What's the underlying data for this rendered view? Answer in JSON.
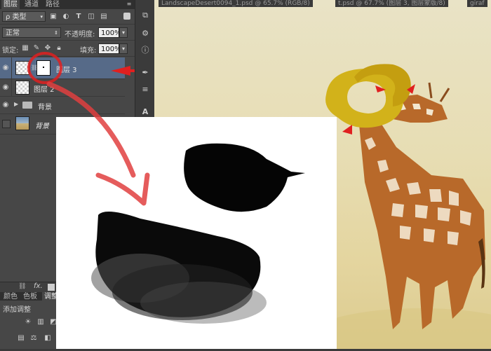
{
  "layers_panel": {
    "tabs": [
      {
        "label": "图层",
        "active": true
      },
      {
        "label": "通道",
        "active": false
      },
      {
        "label": "路径",
        "active": false
      }
    ],
    "filter": {
      "label": "ρ 类型"
    },
    "blend_mode": "正常",
    "opacity_label": "不透明度:",
    "opacity_value": "100%",
    "lock_label": "锁定:",
    "fill_label": "填充:",
    "fill_value": "100%",
    "layers": [
      {
        "name": "图层 3",
        "selected": true,
        "has_mask": true
      },
      {
        "name": "图层 2",
        "selected": false,
        "has_mask": false
      },
      {
        "name": "背景",
        "is_group": true
      },
      {
        "name": "背景",
        "is_background": true
      }
    ],
    "footer": {
      "fx_label": "fx."
    }
  },
  "bottom_panels": {
    "tabs": [
      "颜色",
      "色板",
      "调整"
    ],
    "adjust_label": "添加调整"
  },
  "doc_tabs": [
    "LandscapeDesert0094_1.psd @ 65.7% (RGB/8)",
    "t.psd @ 67.7% (图层 3, 图层蒙版/8)",
    "giraf"
  ],
  "colors": {
    "panel_bg": "#474747",
    "selected_layer": "#566a88",
    "annotation_red": "#e02020",
    "ring_yellow": "#d2b21a",
    "canvas_bg": "#e7ddb3"
  },
  "icons": {
    "eye": "eye-icon",
    "folder": "folder-icon",
    "lock": "lock-icon",
    "link": "link-icon"
  }
}
